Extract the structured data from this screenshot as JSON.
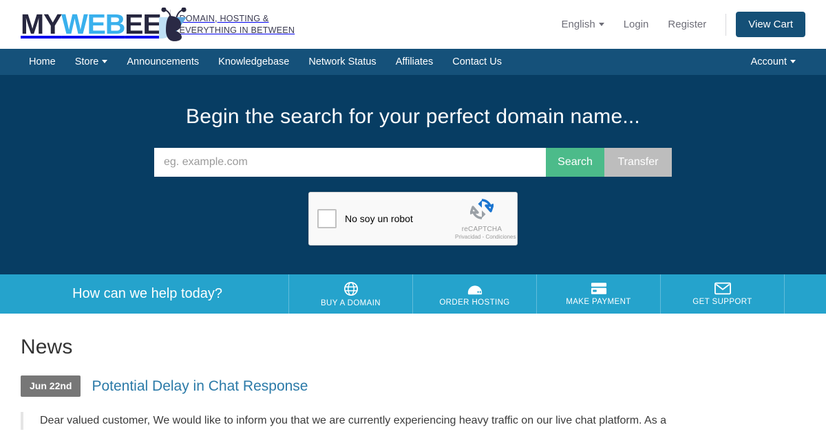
{
  "brand": {
    "logo_part1": "MY",
    "logo_part2": "WEB",
    "logo_part3": "EE",
    "tagline_line1": "DOMAIN, HOSTING &",
    "tagline_line2": "EVERYTHING IN BETWEEN",
    "colors": {
      "dark": "#27273f",
      "light_blue": "#39b0ed",
      "bee_blue": "#2b7fc4"
    }
  },
  "topbar": {
    "language": "English",
    "login": "Login",
    "register": "Register",
    "view_cart": "View Cart"
  },
  "mainnav": {
    "items": [
      {
        "label": "Home",
        "has_caret": false
      },
      {
        "label": "Store",
        "has_caret": true
      },
      {
        "label": "Announcements",
        "has_caret": false
      },
      {
        "label": "Knowledgebase",
        "has_caret": false
      },
      {
        "label": "Network Status",
        "has_caret": false
      },
      {
        "label": "Affiliates",
        "has_caret": false
      },
      {
        "label": "Contact Us",
        "has_caret": false
      }
    ],
    "account": "Account"
  },
  "hero": {
    "title": "Begin the search for your perfect domain name...",
    "search_placeholder": "eg. example.com",
    "search_value": "",
    "search_button": "Search",
    "transfer_button": "Transfer",
    "background_color": "#073d63"
  },
  "recaptcha": {
    "label": "No soy un robot",
    "brand": "reCAPTCHA",
    "legal": "Privacidad - Condiciones",
    "checked": false
  },
  "helpbar": {
    "title": "How can we help today?",
    "background_color": "#25a3cc",
    "items": [
      {
        "label": "BUY A DOMAIN",
        "icon": "globe-icon"
      },
      {
        "label": "ORDER HOSTING",
        "icon": "server-icon"
      },
      {
        "label": "MAKE PAYMENT",
        "icon": "credit-card-icon"
      },
      {
        "label": "GET SUPPORT",
        "icon": "envelope-icon"
      }
    ]
  },
  "news": {
    "heading": "News",
    "date_badge": "Jun 22nd",
    "title": "Potential Delay in Chat Response",
    "body": "Dear valued customer,   We would like to inform you that we are currently experiencing heavy traffic on our live chat platform. As a",
    "link_color": "#2b7aa8",
    "badge_color": "#777777"
  }
}
